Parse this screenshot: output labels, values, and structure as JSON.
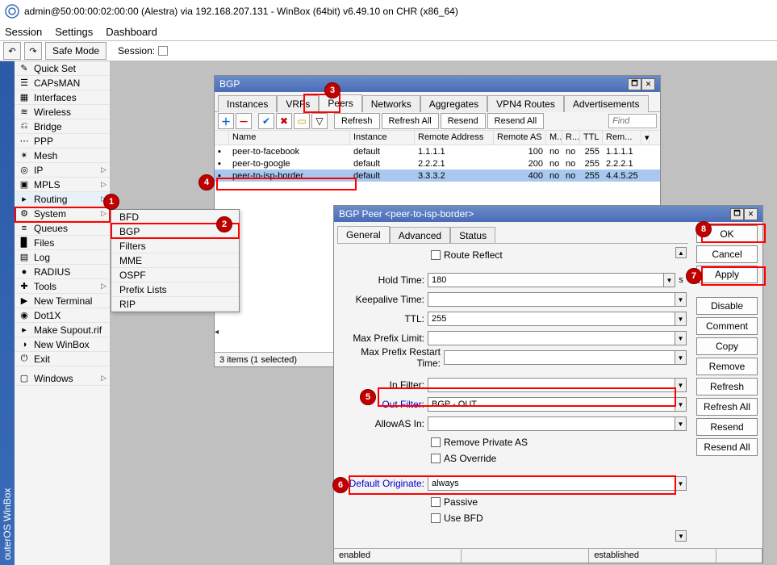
{
  "title": "admin@50:00:00:02:00:00 (Alestra) via 192.168.207.131 - WinBox (64bit) v6.49.10 on CHR (x86_64)",
  "menubar": [
    "Session",
    "Settings",
    "Dashboard"
  ],
  "toolbar": {
    "safemode": "Safe Mode",
    "session_lbl": "Session:"
  },
  "vbar_text": "outerOS WinBox",
  "sidebar": [
    {
      "label": "Quick Set",
      "arrow": false
    },
    {
      "label": "CAPsMAN",
      "arrow": false
    },
    {
      "label": "Interfaces",
      "arrow": false
    },
    {
      "label": "Wireless",
      "arrow": false
    },
    {
      "label": "Bridge",
      "arrow": false
    },
    {
      "label": "PPP",
      "arrow": false
    },
    {
      "label": "Mesh",
      "arrow": false
    },
    {
      "label": "IP",
      "arrow": true
    },
    {
      "label": "MPLS",
      "arrow": true
    },
    {
      "label": "Routing",
      "arrow": true,
      "hl": true
    },
    {
      "label": "System",
      "arrow": true
    },
    {
      "label": "Queues",
      "arrow": false
    },
    {
      "label": "Files",
      "arrow": false
    },
    {
      "label": "Log",
      "arrow": false
    },
    {
      "label": "RADIUS",
      "arrow": false
    },
    {
      "label": "Tools",
      "arrow": true
    },
    {
      "label": "New Terminal",
      "arrow": false
    },
    {
      "label": "Dot1X",
      "arrow": false
    },
    {
      "label": "Make Supout.rif",
      "arrow": false
    },
    {
      "label": "New WinBox",
      "arrow": false
    },
    {
      "label": "Exit",
      "arrow": false
    },
    {
      "label": "",
      "arrow": false,
      "blank": true
    },
    {
      "label": "Windows",
      "arrow": true
    }
  ],
  "submenu": [
    "BFD",
    "BGP",
    "Filters",
    "MME",
    "OSPF",
    "Prefix Lists",
    "RIP"
  ],
  "bgp_win": {
    "title": "BGP",
    "tabs": [
      "Instances",
      "VRFs",
      "Peers",
      "Networks",
      "Aggregates",
      "VPN4 Routes",
      "Advertisements"
    ],
    "active_tab": "Peers",
    "toolbar": {
      "refresh": "Refresh",
      "refresh_all": "Refresh All",
      "resend": "Resend",
      "resend_all": "Resend All",
      "find_placeholder": "Find"
    },
    "cols": [
      "Name",
      "Instance",
      "Remote Address",
      "Remote AS",
      "M...",
      "R...",
      "TTL",
      "Rem..."
    ],
    "rows": [
      {
        "name": "peer-to-facebook",
        "inst": "default",
        "raddr": "1.1.1.1",
        "ras": "100",
        "m": "no",
        "r": "no",
        "ttl": "255",
        "rem": "1.1.1.1"
      },
      {
        "name": "peer-to-google",
        "inst": "default",
        "raddr": "2.2.2.1",
        "ras": "200",
        "m": "no",
        "r": "no",
        "ttl": "255",
        "rem": "2.2.2.1"
      },
      {
        "name": "peer-to-isp-border",
        "inst": "default",
        "raddr": "3.3.3.2",
        "ras": "400",
        "m": "no",
        "r": "no",
        "ttl": "255",
        "rem": "4.4.5.25",
        "sel": true
      }
    ],
    "status": "3 items (1 selected)"
  },
  "peer_win": {
    "title": "BGP Peer <peer-to-isp-border>",
    "tabs": [
      "General",
      "Advanced",
      "Status"
    ],
    "buttons": [
      "OK",
      "Cancel",
      "Apply",
      "Disable",
      "Comment",
      "Copy",
      "Remove",
      "Refresh",
      "Refresh All",
      "Resend",
      "Resend All"
    ],
    "fields": {
      "route_reflect": "Route Reflect",
      "hold_time_lbl": "Hold Time:",
      "hold_time_val": "180",
      "hold_time_unit": "s",
      "keepalive_lbl": "Keepalive Time:",
      "ttl_lbl": "TTL:",
      "ttl_val": "255",
      "max_prefix_lbl": "Max Prefix Limit:",
      "max_prefix_rt_lbl": "Max Prefix Restart Time:",
      "in_filter_lbl": "In Filter:",
      "out_filter_lbl": "Out Filter:",
      "out_filter_val": "BGP - OUT",
      "allowas_lbl": "AllowAS In:",
      "remove_private_as": "Remove Private AS",
      "as_override": "AS Override",
      "default_originate_lbl": "Default Originate:",
      "default_originate_val": "always",
      "passive": "Passive",
      "use_bfd": "Use BFD"
    },
    "status_left": "enabled",
    "status_right": "established"
  },
  "bubbles": [
    "1",
    "2",
    "3",
    "4",
    "5",
    "6",
    "7",
    "8"
  ]
}
